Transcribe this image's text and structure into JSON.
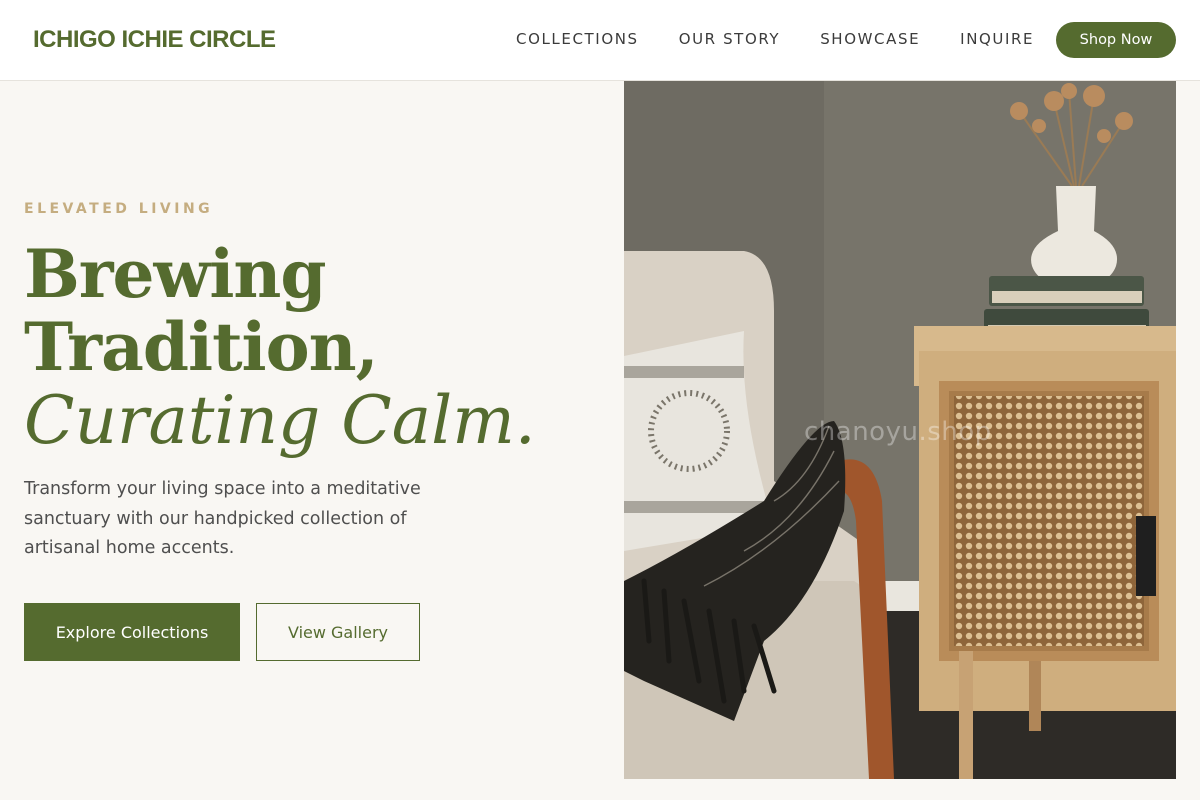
{
  "header": {
    "brand": "ICHIGO ICHIE CIRCLE",
    "nav": [
      {
        "label": "COLLECTIONS"
      },
      {
        "label": "OUR STORY"
      },
      {
        "label": "SHOWCASE"
      },
      {
        "label": "INQUIRE"
      }
    ],
    "cta_label": "Shop Now"
  },
  "hero": {
    "eyebrow": "ELEVATED LIVING",
    "headline_line1": "Brewing",
    "headline_line2": "Tradition,",
    "headline_line3": "Curating Calm.",
    "subcopy": "Transform your living space into a meditative sanctuary with our handpicked collection of artisanal home accents.",
    "primary_button": "Explore Collections",
    "secondary_button": "View Gallery",
    "image_watermark": "chanoyu.shop"
  },
  "colors": {
    "brand_green": "#556b2f",
    "accent_gold": "#c5ad80",
    "background": "#f9f7f3"
  }
}
